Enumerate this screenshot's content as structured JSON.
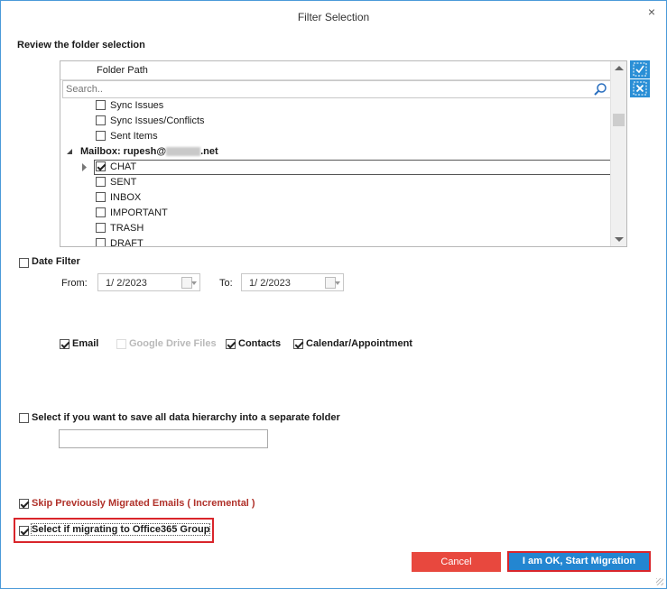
{
  "window": {
    "title": "Filter Selection",
    "close_glyph": "×"
  },
  "folder_section": {
    "heading": "Review the folder selection",
    "column_header": "Folder Path",
    "search_placeholder": "Search..",
    "mailbox_label": "Mailbox: rupesh@",
    "mailbox_suffix": ".net",
    "folders": [
      {
        "label": "Sync Issues",
        "checked": false
      },
      {
        "label": "Sync Issues/Conflicts",
        "checked": false
      },
      {
        "label": "Sent Items",
        "checked": false
      },
      {
        "label": "CHAT",
        "checked": true,
        "selected": true
      },
      {
        "label": "SENT",
        "checked": false
      },
      {
        "label": "INBOX",
        "checked": false
      },
      {
        "label": "IMPORTANT",
        "checked": false
      },
      {
        "label": "TRASH",
        "checked": false
      },
      {
        "label": "DRAFT",
        "checked": false
      }
    ],
    "select_all_icon": "check-all-icon",
    "deselect_all_icon": "uncheck-all-icon"
  },
  "date_filter": {
    "label": "Date Filter",
    "checked": false,
    "from_label": "From:",
    "from_value": "1/  2/2023",
    "to_label": "To:",
    "to_value": "1/  2/2023"
  },
  "categories": {
    "email": {
      "label": "Email",
      "checked": true
    },
    "google_drive": {
      "label": "Google Drive Files",
      "checked": false,
      "disabled": true
    },
    "contacts": {
      "label": "Contacts",
      "checked": true
    },
    "calendar": {
      "label": "Calendar/Appointment",
      "checked": true
    }
  },
  "hierarchy": {
    "label": "Select if you want to save all data hierarchy into a separate folder",
    "checked": false,
    "folder_value": ""
  },
  "incremental": {
    "label": "Skip Previously Migrated Emails ( Incremental )",
    "checked": true
  },
  "office365_group": {
    "label": "Select if migrating to Office365 Group",
    "checked": true
  },
  "buttons": {
    "cancel": "Cancel",
    "start": "I am OK, Start Migration"
  },
  "colors": {
    "accent_blue": "#2386d1",
    "cancel_red": "#e8483e",
    "highlight_red": "#d9252b",
    "incremental_text": "#b0312a"
  }
}
